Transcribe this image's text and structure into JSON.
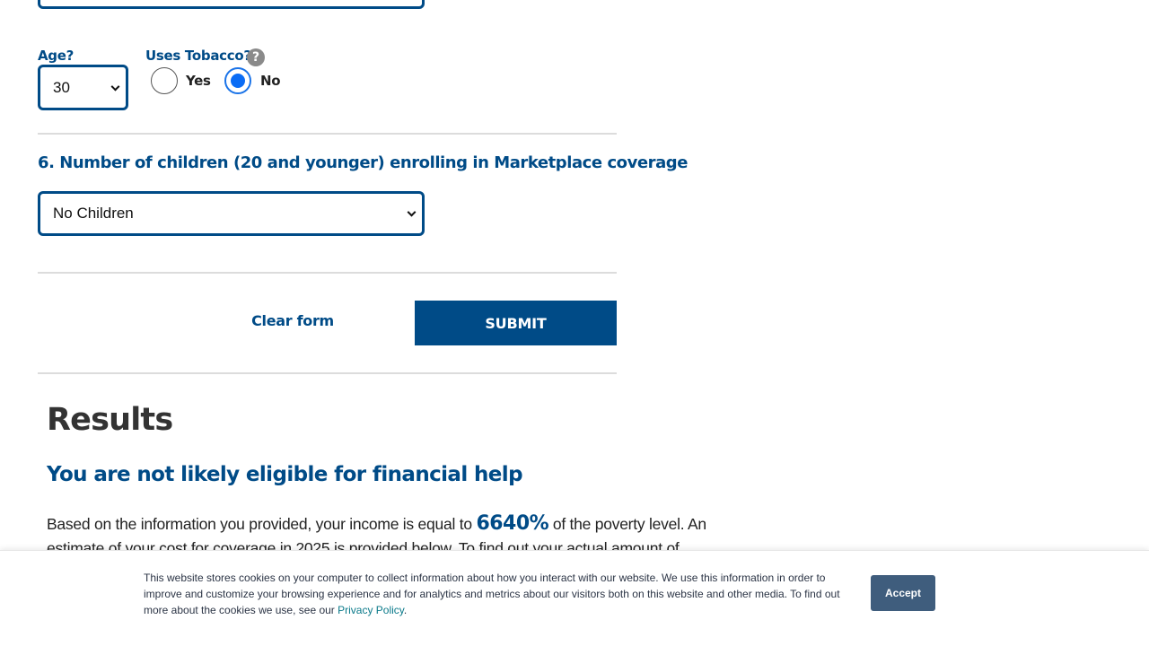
{
  "form": {
    "age": {
      "label": "Age?",
      "value": "30"
    },
    "tobacco": {
      "label": "Uses Tobacco?",
      "help_glyph": "?",
      "options": [
        {
          "label": "Yes",
          "selected": false
        },
        {
          "label": "No",
          "selected": true
        }
      ]
    },
    "children": {
      "question": "6. Number of children (20 and younger) enrolling in Marketplace coverage",
      "value": "No Children"
    },
    "clear_label": "Clear form",
    "submit_label": "SUBMIT"
  },
  "results": {
    "title": "Results",
    "eligibility": "You are not likely eligible for financial help",
    "para_before": "Based on the information you provided, your income is equal to ",
    "percent": "6640%",
    "para_after": " of the poverty level. An estimate of your cost for coverage in 2025 is provided below. To find out your actual amount of"
  },
  "cookie_banner": {
    "text": "This website stores cookies on your computer to collect information about how you interact with our website. We use this information in order to improve and customize your browsing experience and for analytics and metrics about our visitors both on this website and other media. To find out more about the cookies we use, see our ",
    "link": "Privacy Policy",
    "end": ".",
    "accept_label": "Accept"
  },
  "colors": {
    "primary": "#004b87",
    "radio_selected": "#0a6cf5",
    "accept_button": "#3f5d7d"
  },
  "icons": [
    "help-icon",
    "chevron-down-icon"
  ]
}
